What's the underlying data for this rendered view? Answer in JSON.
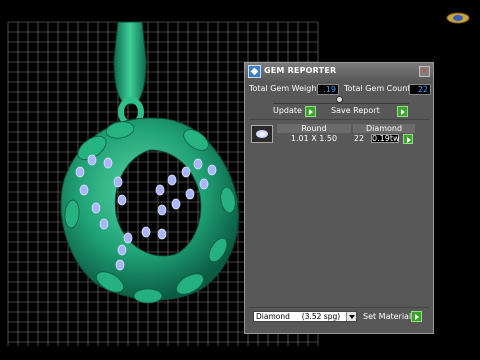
{
  "panel": {
    "title": "GEM REPORTER",
    "total_weight_label": "Total Gem Weight",
    "total_weight_value": ".19",
    "total_count_label": "Total Gem Count",
    "total_count_value": "22",
    "update_label": "Update",
    "save_report_label": "Save Report",
    "table": {
      "columns": [
        "Round",
        "Diamond"
      ],
      "rows": [
        {
          "shape": "Round",
          "size": "1.01 X 1.50",
          "count": "22",
          "weight": "0.19tw"
        }
      ]
    },
    "material_select_value": "Diamond     (3.52 spg)",
    "set_material_label": "Set Material"
  },
  "icons": {
    "app": "gem-reporter-app-icon",
    "close": "close-icon",
    "arrow": "play-arrow-icon",
    "compass": "view-orientation-icon",
    "thumbnail": "round-gem-icon"
  },
  "colors": {
    "background": "#000000",
    "grid": "#7d7d7d",
    "model": "#1f9f74",
    "gem": "#9aa8ff",
    "accent_value": "#4aa3ff",
    "action_green": "#3aa52a"
  }
}
